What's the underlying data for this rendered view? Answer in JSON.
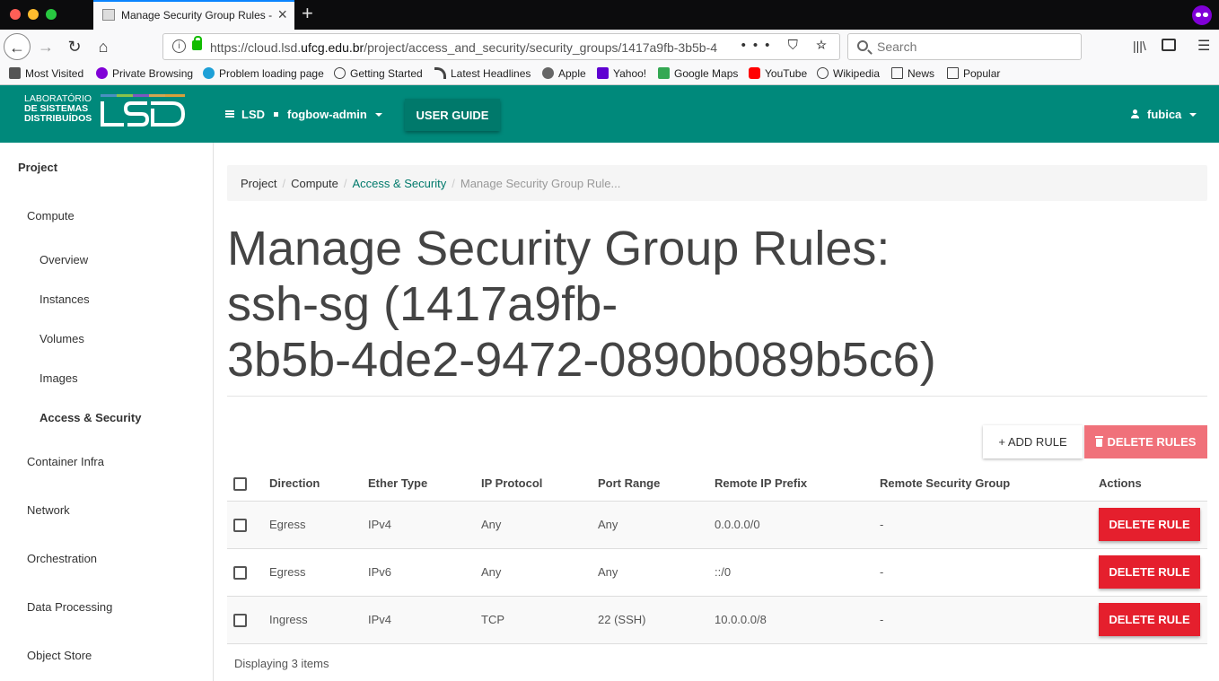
{
  "browser": {
    "tab_title": "Manage Security Group Rules -",
    "url_prefix": "https://cloud.lsd.",
    "url_domain": "ufcg.edu.br",
    "url_path": "/project/access_and_security/security_groups/1417a9fb-3b5b-4",
    "search_placeholder": "Search",
    "bookmarks": [
      {
        "label": "Most Visited",
        "icon": "gear-icon"
      },
      {
        "label": "Private Browsing",
        "icon": "mask-icon"
      },
      {
        "label": "Problem loading page",
        "icon": "globe-icon"
      },
      {
        "label": "Getting Started",
        "icon": "globe-icon"
      },
      {
        "label": "Latest Headlines",
        "icon": "rss-icon"
      },
      {
        "label": "Apple",
        "icon": "apple-icon"
      },
      {
        "label": "Yahoo!",
        "icon": "yahoo-icon"
      },
      {
        "label": "Google Maps",
        "icon": "maps-icon"
      },
      {
        "label": "YouTube",
        "icon": "youtube-icon"
      },
      {
        "label": "Wikipedia",
        "icon": "globe-icon"
      },
      {
        "label": "News",
        "icon": "folder-icon"
      },
      {
        "label": "Popular",
        "icon": "folder-icon"
      }
    ]
  },
  "header": {
    "logo_line1": "LABORATÓRIO",
    "logo_line2": "DE SISTEMAS",
    "logo_line3": "DISTRIBUÍDOS",
    "domain": "LSD",
    "project": "fogbow-admin",
    "user_guide": "USER GUIDE",
    "user": "fubica",
    "accent_color": "#00897b"
  },
  "sidebar": {
    "project": "Project",
    "compute": "Compute",
    "items": [
      "Overview",
      "Instances",
      "Volumes",
      "Images",
      "Access & Security"
    ],
    "sections": [
      "Container Infra",
      "Network",
      "Orchestration",
      "Data Processing",
      "Object Store"
    ]
  },
  "breadcrumb": {
    "items": [
      "Project",
      "Compute",
      "Access & Security",
      "Manage Security Group Rule..."
    ]
  },
  "main": {
    "title_line1": "Manage Security Group Rules:",
    "title_line2": "ssh-sg (1417a9fb-",
    "title_line3": "3b5b-4de2-9472-0890b089b5c6)",
    "add_rule": "ADD RULE",
    "delete_rules": "DELETE RULES",
    "columns": [
      "Direction",
      "Ether Type",
      "IP Protocol",
      "Port Range",
      "Remote IP Prefix",
      "Remote Security Group",
      "Actions"
    ],
    "rows": [
      {
        "direction": "Egress",
        "ether": "IPv4",
        "protocol": "Any",
        "port": "Any",
        "prefix": "0.0.0.0/0",
        "group": "-",
        "action": "DELETE RULE"
      },
      {
        "direction": "Egress",
        "ether": "IPv6",
        "protocol": "Any",
        "port": "Any",
        "prefix": "::/0",
        "group": "-",
        "action": "DELETE RULE"
      },
      {
        "direction": "Ingress",
        "ether": "IPv4",
        "protocol": "TCP",
        "port": "22 (SSH)",
        "prefix": "10.0.0.0/8",
        "group": "-",
        "action": "DELETE RULE"
      }
    ],
    "footer": "Displaying 3 items",
    "delete_color": "#e51f2d"
  }
}
